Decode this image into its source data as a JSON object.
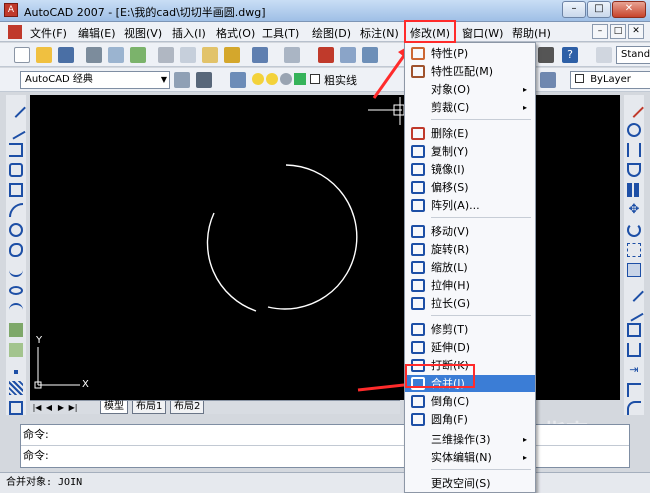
{
  "window": {
    "title": "AutoCAD 2007 - [E:\\我的cad\\切切半画圆.dwg]",
    "btn_min": "–",
    "btn_max": "□",
    "btn_close": "✕"
  },
  "menubar": {
    "items": [
      "文件(F)",
      "编辑(E)",
      "视图(V)",
      "插入(I)",
      "格式(O)",
      "工具(T)",
      "绘图(D)",
      "标注(N)",
      "修改(M)",
      "窗口(W)",
      "帮助(H)"
    ],
    "doc_min": "–",
    "doc_max": "□",
    "doc_close": "✕"
  },
  "toolbar2": {
    "workspace": "AutoCAD 经典",
    "layer_text": "粗实线",
    "bylayer": "ByLayer",
    "standard": "Stand"
  },
  "canvas": {
    "ucs_y": "Y",
    "ucs_x": "X"
  },
  "tabs": {
    "nav": [
      "|◀",
      "◀",
      "▶",
      "▶|"
    ],
    "items": [
      "模型",
      "布局1",
      "布局2"
    ]
  },
  "command": {
    "line1": "命令:",
    "line2": "命令:"
  },
  "status": {
    "text": "合并对象: JOIN"
  },
  "modify_menu": {
    "items": [
      {
        "label": "特性(P)",
        "icon": "properties-icon",
        "submenu": false
      },
      {
        "label": "特性匹配(M)",
        "icon": "match-properties-icon",
        "submenu": false
      },
      {
        "label": "对象(O)",
        "icon": "",
        "submenu": true
      },
      {
        "label": "剪裁(C)",
        "icon": "",
        "submenu": true
      },
      {
        "label": "删除(E)",
        "icon": "erase-icon",
        "submenu": false
      },
      {
        "label": "复制(Y)",
        "icon": "copy-icon",
        "submenu": false
      },
      {
        "label": "镜像(I)",
        "icon": "mirror-icon",
        "submenu": false
      },
      {
        "label": "偏移(S)",
        "icon": "offset-icon",
        "submenu": false
      },
      {
        "label": "阵列(A)...",
        "icon": "array-icon",
        "submenu": false
      },
      {
        "label": "移动(V)",
        "icon": "move-icon",
        "submenu": false
      },
      {
        "label": "旋转(R)",
        "icon": "rotate-icon",
        "submenu": false
      },
      {
        "label": "缩放(L)",
        "icon": "scale-icon",
        "submenu": false
      },
      {
        "label": "拉伸(H)",
        "icon": "stretch-icon",
        "submenu": false
      },
      {
        "label": "拉长(G)",
        "icon": "lengthen-icon",
        "submenu": false
      },
      {
        "label": "修剪(T)",
        "icon": "trim-icon",
        "submenu": false
      },
      {
        "label": "延伸(D)",
        "icon": "extend-icon",
        "submenu": false
      },
      {
        "label": "打断(K)",
        "icon": "break-icon",
        "submenu": false
      },
      {
        "label": "合并(J)",
        "icon": "join-icon",
        "submenu": false
      },
      {
        "label": "倒角(C)",
        "icon": "chamfer-icon",
        "submenu": false
      },
      {
        "label": "圆角(F)",
        "icon": "fillet-icon",
        "submenu": false
      },
      {
        "label": "三维操作(3)",
        "icon": "",
        "submenu": true
      },
      {
        "label": "实体编辑(N)",
        "icon": "",
        "submenu": true
      },
      {
        "label": "更改空间(S)",
        "icon": "",
        "submenu": false
      }
    ]
  },
  "submenu_arrow": "▸",
  "watermark": "搜狗指南",
  "colors": {
    "accent": "#3b7dd6",
    "highlight_box": "#ff2b2b",
    "canvas": "#000000"
  }
}
